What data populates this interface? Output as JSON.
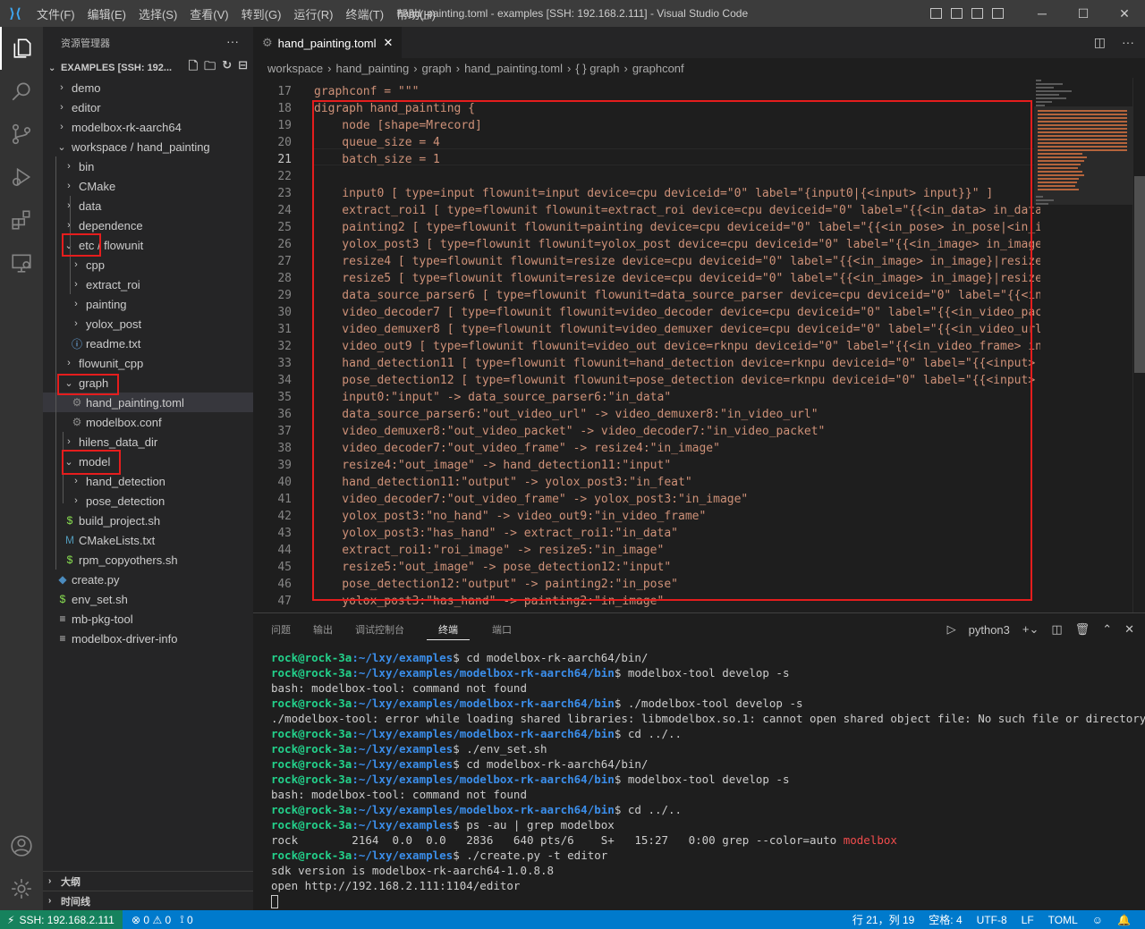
{
  "titlebar": {
    "menu": [
      "文件(F)",
      "编辑(E)",
      "选择(S)",
      "查看(V)",
      "转到(G)",
      "运行(R)",
      "终端(T)",
      "帮助(H)"
    ],
    "title": "hand_painting.toml - examples [SSH: 192.168.2.111] - Visual Studio Code"
  },
  "sidebar": {
    "header": "资源管理器",
    "section_title": "EXAMPLES [SSH: 192...",
    "tree": [
      {
        "label": "demo",
        "type": "folder",
        "open": false
      },
      {
        "label": "editor",
        "type": "folder",
        "open": false
      },
      {
        "label": "modelbox-rk-aarch64",
        "type": "folder",
        "open": false
      },
      {
        "label": "workspace / hand_painting",
        "type": "folder",
        "open": true
      },
      {
        "label": "bin",
        "type": "folder",
        "open": false
      },
      {
        "label": "CMake",
        "type": "folder",
        "open": false
      },
      {
        "label": "data",
        "type": "folder",
        "open": false
      },
      {
        "label": "dependence",
        "type": "folder",
        "open": false
      },
      {
        "label": "etc / flowunit",
        "type": "folder",
        "open": true
      },
      {
        "label": "cpp",
        "type": "folder",
        "open": false
      },
      {
        "label": "extract_roi",
        "type": "folder",
        "open": false
      },
      {
        "label": "painting",
        "type": "folder",
        "open": false
      },
      {
        "label": "yolox_post",
        "type": "folder",
        "open": false
      },
      {
        "label": "readme.txt",
        "type": "info"
      },
      {
        "label": "flowunit_cpp",
        "type": "folder",
        "open": false
      },
      {
        "label": "graph",
        "type": "folder",
        "open": true
      },
      {
        "label": "hand_painting.toml",
        "type": "gear"
      },
      {
        "label": "modelbox.conf",
        "type": "gear"
      },
      {
        "label": "hilens_data_dir",
        "type": "folder",
        "open": false
      },
      {
        "label": "model",
        "type": "folder",
        "open": true
      },
      {
        "label": "hand_detection",
        "type": "folder",
        "open": false
      },
      {
        "label": "pose_detection",
        "type": "folder",
        "open": false
      },
      {
        "label": "build_project.sh",
        "type": "shell"
      },
      {
        "label": "CMakeLists.txt",
        "type": "cmake"
      },
      {
        "label": "rpm_copyothers.sh",
        "type": "shell"
      },
      {
        "label": "create.py",
        "type": "python"
      },
      {
        "label": "env_set.sh",
        "type": "shell"
      },
      {
        "label": "mb-pkg-tool",
        "type": "text"
      },
      {
        "label": "modelbox-driver-info",
        "type": "text"
      }
    ],
    "outline": "大纲",
    "timeline": "时间线"
  },
  "editor": {
    "tab": "hand_painting.toml",
    "breadcrumb": [
      "workspace",
      "hand_painting",
      "graph",
      "hand_painting.toml",
      "{ } graph",
      "graphconf"
    ],
    "lines": [
      {
        "n": "17",
        "t": "graphconf = \"\"\""
      },
      {
        "n": "18",
        "t": "digraph hand_painting {"
      },
      {
        "n": "19",
        "t": "    node [shape=Mrecord]"
      },
      {
        "n": "20",
        "t": "    queue_size = 4"
      },
      {
        "n": "21",
        "t": "    batch_size = 1"
      },
      {
        "n": "22",
        "t": ""
      },
      {
        "n": "23",
        "t": "    input0 [ type=input flowunit=input device=cpu deviceid=\"0\" label=\"{input0|{<input> input}}\" ]"
      },
      {
        "n": "24",
        "t": "    extract_roi1 [ type=flowunit flowunit=extract_roi device=cpu deviceid=\"0\" label=\"{{<in_data> in_data"
      },
      {
        "n": "25",
        "t": "    painting2 [ type=flowunit flowunit=painting device=cpu deviceid=\"0\" label=\"{{<in_pose> in_pose|<in_i"
      },
      {
        "n": "26",
        "t": "    yolox_post3 [ type=flowunit flowunit=yolox_post device=cpu deviceid=\"0\" label=\"{{<in_image> in_image"
      },
      {
        "n": "27",
        "t": "    resize4 [ type=flowunit flowunit=resize device=cpu deviceid=\"0\" label=\"{{<in_image> in_image}|resize"
      },
      {
        "n": "28",
        "t": "    resize5 [ type=flowunit flowunit=resize device=cpu deviceid=\"0\" label=\"{{<in_image> in_image}|resize"
      },
      {
        "n": "29",
        "t": "    data_source_parser6 [ type=flowunit flowunit=data_source_parser device=cpu deviceid=\"0\" label=\"{{<in"
      },
      {
        "n": "30",
        "t": "    video_decoder7 [ type=flowunit flowunit=video_decoder device=cpu deviceid=\"0\" label=\"{{<in_video_pac"
      },
      {
        "n": "31",
        "t": "    video_demuxer8 [ type=flowunit flowunit=video_demuxer device=cpu deviceid=\"0\" label=\"{{<in_video_url"
      },
      {
        "n": "32",
        "t": "    video_out9 [ type=flowunit flowunit=video_out device=rknpu deviceid=\"0\" label=\"{{<in_video_frame> in"
      },
      {
        "n": "33",
        "t": "    hand_detection11 [ type=flowunit flowunit=hand_detection device=rknpu deviceid=\"0\" label=\"{{<input>"
      },
      {
        "n": "34",
        "t": "    pose_detection12 [ type=flowunit flowunit=pose_detection device=rknpu deviceid=\"0\" label=\"{{<input>"
      },
      {
        "n": "35",
        "t": "    input0:\"input\" -> data_source_parser6:\"in_data\""
      },
      {
        "n": "36",
        "t": "    data_source_parser6:\"out_video_url\" -> video_demuxer8:\"in_video_url\""
      },
      {
        "n": "37",
        "t": "    video_demuxer8:\"out_video_packet\" -> video_decoder7:\"in_video_packet\""
      },
      {
        "n": "38",
        "t": "    video_decoder7:\"out_video_frame\" -> resize4:\"in_image\""
      },
      {
        "n": "39",
        "t": "    resize4:\"out_image\" -> hand_detection11:\"input\""
      },
      {
        "n": "40",
        "t": "    hand_detection11:\"output\" -> yolox_post3:\"in_feat\""
      },
      {
        "n": "41",
        "t": "    video_decoder7:\"out_video_frame\" -> yolox_post3:\"in_image\""
      },
      {
        "n": "42",
        "t": "    yolox_post3:\"no_hand\" -> video_out9:\"in_video_frame\""
      },
      {
        "n": "43",
        "t": "    yolox_post3:\"has_hand\" -> extract_roi1:\"in_data\""
      },
      {
        "n": "44",
        "t": "    extract_roi1:\"roi_image\" -> resize5:\"in_image\""
      },
      {
        "n": "45",
        "t": "    resize5:\"out_image\" -> pose_detection12:\"input\""
      },
      {
        "n": "46",
        "t": "    pose_detection12:\"output\" -> painting2:\"in_pose\""
      },
      {
        "n": "47",
        "t": "    yolox_post3:\"has_hand\" -> painting2:\"in_image\""
      }
    ]
  },
  "panel": {
    "tabs": [
      "问题",
      "输出",
      "调试控制台",
      "终端",
      "端口"
    ],
    "active_tab": "终端",
    "shell": "python3",
    "terminal": [
      {
        "user": "rock@rock-3a",
        "path": ":~/lxy/examples",
        "cmd": "$ cd modelbox-rk-aarch64/bin/"
      },
      {
        "user": "rock@rock-3a",
        "path": ":~/lxy/examples/modelbox-rk-aarch64/bin",
        "cmd": "$ modelbox-tool develop -s"
      },
      {
        "out": "bash: modelbox-tool: command not found"
      },
      {
        "user": "rock@rock-3a",
        "path": ":~/lxy/examples/modelbox-rk-aarch64/bin",
        "cmd": "$ ./modelbox-tool develop -s"
      },
      {
        "out": "./modelbox-tool: error while loading shared libraries: libmodelbox.so.1: cannot open shared object file: No such file or directory"
      },
      {
        "user": "rock@rock-3a",
        "path": ":~/lxy/examples/modelbox-rk-aarch64/bin",
        "cmd": "$ cd ../.."
      },
      {
        "user": "rock@rock-3a",
        "path": ":~/lxy/examples",
        "cmd": "$ ./env_set.sh"
      },
      {
        "user": "rock@rock-3a",
        "path": ":~/lxy/examples",
        "cmd": "$ cd modelbox-rk-aarch64/bin/"
      },
      {
        "user": "rock@rock-3a",
        "path": ":~/lxy/examples/modelbox-rk-aarch64/bin",
        "cmd": "$ modelbox-tool develop -s"
      },
      {
        "out": "bash: modelbox-tool: command not found"
      },
      {
        "user": "rock@rock-3a",
        "path": ":~/lxy/examples/modelbox-rk-aarch64/bin",
        "cmd": "$ cd ../.."
      },
      {
        "user": "rock@rock-3a",
        "path": ":~/lxy/examples",
        "cmd": "$ ps -au | grep modelbox"
      },
      {
        "out": "rock        2164  0.0  0.0   2836   640 pts/6    S+   15:27   0:00 grep --color=auto ",
        "hl": "modelbox"
      },
      {
        "user": "rock@rock-3a",
        "path": ":~/lxy/examples",
        "cmd": "$ ./create.py -t editor"
      },
      {
        "out": "sdk version is modelbox-rk-aarch64-1.0.8.8"
      },
      {
        "out": "open http://192.168.2.111:1104/editor"
      }
    ]
  },
  "statusbar": {
    "remote": "SSH: 192.168.2.111",
    "errors": "0",
    "warnings": "0",
    "ports": "0",
    "position": "行 21，列 19",
    "spaces": "空格: 4",
    "encoding": "UTF-8",
    "eol": "LF",
    "language": "TOML"
  },
  "colors": {
    "accent": "#007acc",
    "remote": "#16825d",
    "highlight_box": "#e51d1d"
  }
}
